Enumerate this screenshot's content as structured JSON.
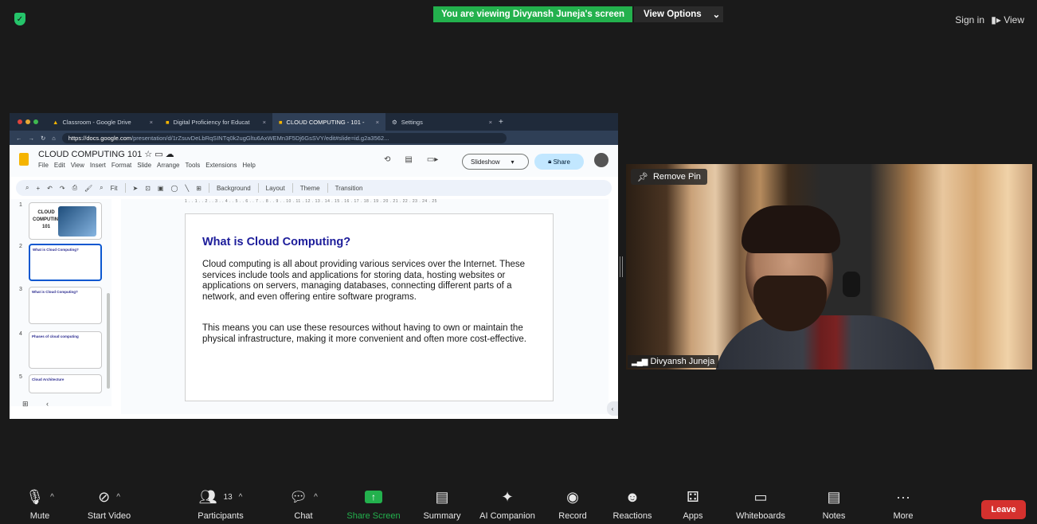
{
  "top": {
    "viewing_banner": "You are viewing Divyansh Juneja's screen",
    "view_options": "View Options",
    "sign_in": "Sign in",
    "view": "View"
  },
  "browser": {
    "tabs": [
      {
        "label": "Classroom - Google Drive"
      },
      {
        "label": "Digital Proficiency for Educat"
      },
      {
        "label": "CLOUD COMPUTING - 101 - "
      },
      {
        "label": "Settings"
      }
    ],
    "url_host": "https://docs.google.com",
    "url_path": "/presentation/d/1rZsuvDeLbRqSINTq0k2ugGltu6AxWEMn3F5Dj6GsSVY/edit#slide=id.g2a3562..."
  },
  "docs": {
    "title": "CLOUD COMPUTING 101",
    "menu": [
      "File",
      "Edit",
      "View",
      "Insert",
      "Format",
      "Slide",
      "Arrange",
      "Tools",
      "Extensions",
      "Help"
    ],
    "slideshow_label": "Slideshow",
    "share_label": "Share",
    "toolbar": {
      "zoom": "Fit",
      "background": "Background",
      "layout": "Layout",
      "theme": "Theme",
      "transition": "Transition"
    },
    "ruler": "1 . . 1 . . 2 . . 3 . . 4 . . 5 . . 6 . . 7 . . 8 . . 9 . . 10 . 11 . 12 . 13 . 14 . 15 . 16 . 17 . 18 . 19 . 20 . 21 . 22 . 23 . 24 . 25",
    "thumbnails": [
      {
        "num": "1",
        "title": "CLOUD COMPUTING 101"
      },
      {
        "num": "2",
        "title": "What is Cloud Computing?"
      },
      {
        "num": "3",
        "title": "What is Cloud Computing?"
      },
      {
        "num": "4",
        "title": "Phases of cloud computing"
      },
      {
        "num": "5",
        "title": "Cloud Architecture"
      }
    ],
    "slide": {
      "title": "What is Cloud Computing?",
      "p1": "Cloud computing is all about providing various services over the Internet. These services include tools and applications for storing data, hosting websites or applications on servers, managing databases, connecting different parts of a network, and even offering entire software programs.",
      "p2": "This means you can use these resources without having to own or maintain the physical infrastructure, making it more convenient and often more cost-effective."
    }
  },
  "video": {
    "remove_pin": "Remove Pin",
    "name": "Divyansh Juneja"
  },
  "toolbar": {
    "mute": "Mute",
    "start_video": "Start Video",
    "participants": "Participants",
    "participants_count": "13",
    "chat": "Chat",
    "share_screen": "Share Screen",
    "summary": "Summary",
    "ai_companion": "AI Companion",
    "record": "Record",
    "reactions": "Reactions",
    "apps": "Apps",
    "whiteboards": "Whiteboards",
    "notes": "Notes",
    "more": "More",
    "leave": "Leave"
  },
  "colors": {
    "accent_green": "#23b14d",
    "leave_red": "#d5312e",
    "slide_title_blue": "#1c1c9a"
  }
}
